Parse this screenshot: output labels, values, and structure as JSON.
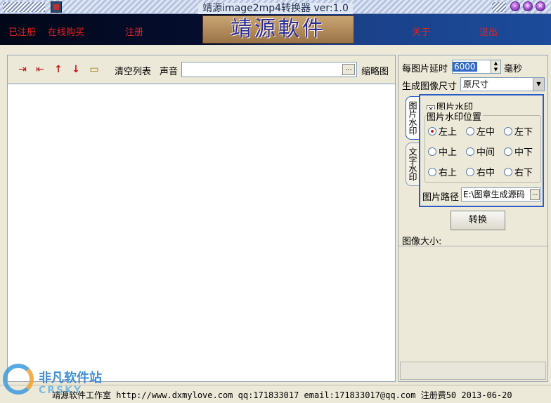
{
  "window": {
    "title": "靖源image2mp4转换器 ver:1.0",
    "icons": [
      "app-icon",
      "minimize-icon",
      "maximize-icon",
      "close-icon"
    ]
  },
  "banner": {
    "registered": "已注册",
    "buy_online": "在线购买",
    "register": "注册",
    "logo_text": "靖源軟件",
    "about": "关于",
    "exit": "退出"
  },
  "toolbar": {
    "icons": [
      "add-files-icon",
      "remove-files-icon",
      "move-up-icon",
      "move-down-icon",
      "open-folder-icon"
    ],
    "clear_list": "清空列表",
    "sound_label": "声音",
    "sound_value": "",
    "browse": "...",
    "thumbnail": "缩略图"
  },
  "settings": {
    "delay_label": "每图片延时",
    "delay_value": "6000",
    "delay_unit": "毫秒",
    "size_label": "生成图像尺寸",
    "size_value": "原尺寸"
  },
  "tabs": {
    "image_watermark": "图片水印",
    "text_watermark": "文字水印"
  },
  "watermark_panel": {
    "enable_label": "图片水印",
    "enabled": true,
    "position_group": "图片水印位置",
    "positions": [
      "左上",
      "左中",
      "左下",
      "中上",
      "中间",
      "中下",
      "右上",
      "右中",
      "右下"
    ],
    "selected_position": "左上",
    "path_label": "图片路径",
    "path_value": "E:\\图章生成源码"
  },
  "actions": {
    "convert": "转换",
    "image_size_label": "图像大小:"
  },
  "status": {
    "text": "靖源软件工作室 http://www.dxmylove.com qq:171833017 email:171833017@qq.com 注册费50 2013-06-20"
  },
  "watermark_logo": {
    "cn": "非凡软件站",
    "en": "CRSKY"
  }
}
